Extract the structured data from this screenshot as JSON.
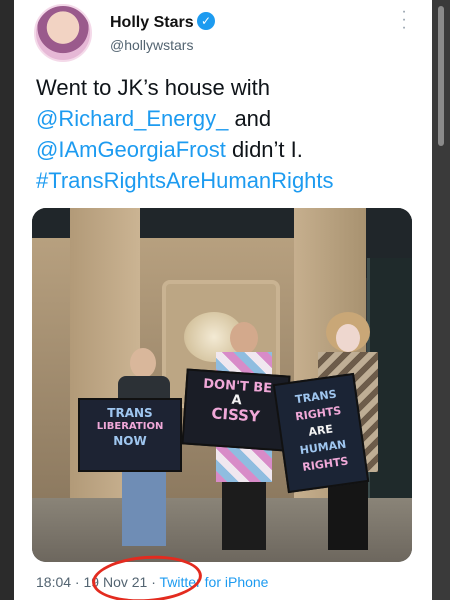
{
  "tweet": {
    "author": {
      "display_name": "Holly Stars",
      "handle": "@hollywstars",
      "verified_icon": "check-icon"
    },
    "more_icon": "vertical-dots-icon",
    "text_lines": [
      {
        "text": "Went to JK’s house with"
      },
      {
        "mention": "@Richard_Energy_",
        "text": " and"
      },
      {
        "mention": "@IAmGeorgiaFrost",
        "text": " didn’t I."
      },
      {
        "hashtag": "#TransRightsAreHumanRights"
      }
    ],
    "photo": {
      "signs": {
        "left": [
          "TRANS",
          "LIBERATION",
          "NOW"
        ],
        "middle": [
          "DON'T BE",
          "A",
          "CISSY"
        ],
        "right": [
          "TRANS",
          "RIGHTS",
          "ARE",
          "HUMAN",
          "RIGHTS"
        ]
      }
    },
    "meta": {
      "time": "18:04",
      "sep1": " · ",
      "date": "19 Nov 21",
      "sep2": " · ",
      "source": "Twitter for iPhone"
    }
  },
  "colors": {
    "link": "#1d9bf0",
    "annotation": "#e32b1f"
  }
}
